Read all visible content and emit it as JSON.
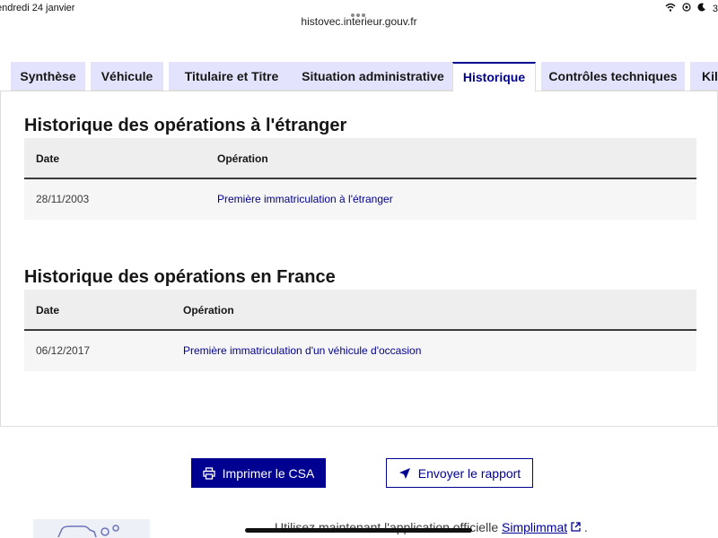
{
  "statusbar": {
    "date": "endredi 24 janvier",
    "url": "histovec.interieur.gouv.fr",
    "battery": "3"
  },
  "tabs": [
    {
      "label": "Synthèse",
      "active": false
    },
    {
      "label": "Véhicule",
      "active": false
    },
    {
      "label": "Titulaire et Titre",
      "active": false
    },
    {
      "label": "Situation administrative",
      "active": false
    },
    {
      "label": "Historique",
      "active": true
    },
    {
      "label": "Contrôles techniques",
      "active": false
    },
    {
      "label": "Kilo",
      "active": false
    }
  ],
  "foreign": {
    "title": "Historique des opérations à l'étranger",
    "col_date": "Date",
    "col_operation": "Opération",
    "rows": [
      {
        "date": "28/11/2003",
        "operation": "Première immatriculation à l'étranger"
      }
    ]
  },
  "france": {
    "title": "Historique des opérations en France",
    "col_date": "Date",
    "col_operation": "Opération",
    "rows": [
      {
        "date": "06/12/2017",
        "operation": "Première immatriculation d'un véhicule d'occasion"
      }
    ]
  },
  "actions": {
    "print_label": "Imprimer le CSA",
    "send_label": "Envoyer le rapport"
  },
  "promo": {
    "text": "Utilisez maintenant l'application officielle",
    "link": "Simplimmat",
    "suffix": "."
  },
  "colors": {
    "primary": "#000091",
    "tab_bg": "#e3e3fd",
    "header_bg": "#eeeeee",
    "row_bg": "#f6f6f6"
  }
}
